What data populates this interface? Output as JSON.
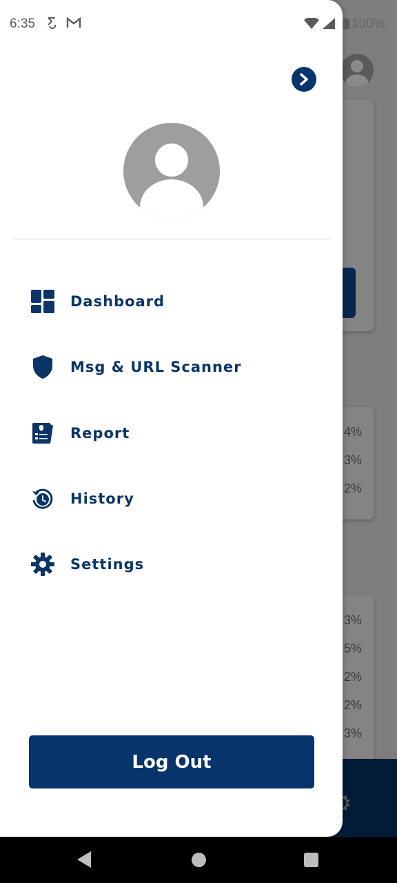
{
  "status_bar": {
    "time": "6:35",
    "battery": "100%"
  },
  "drawer": {
    "menu": [
      {
        "label": "Dashboard",
        "icon": "dashboard-icon"
      },
      {
        "label": "Msg & URL Scanner",
        "icon": "shield-icon"
      },
      {
        "label": "Report",
        "icon": "report-icon"
      },
      {
        "label": "History",
        "icon": "history-icon"
      },
      {
        "label": "Settings",
        "icon": "gear-icon"
      }
    ],
    "logout_label": "Log Out"
  },
  "background": {
    "percent_values_a": [
      "4%",
      "3%",
      "2%"
    ],
    "percent_values_b": [
      "3%",
      "5%",
      "2%",
      "2%",
      "3%"
    ]
  },
  "colors": {
    "primary": "#06346b",
    "label": "#0b3566",
    "scrim": "#7e7e7e"
  }
}
